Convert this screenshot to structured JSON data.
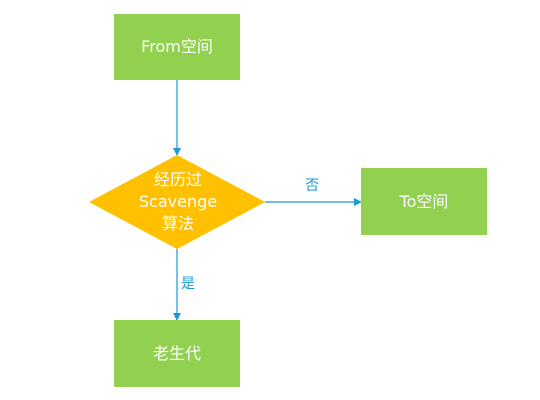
{
  "nodes": {
    "from_space": "From空间",
    "decision_line1": "经历过",
    "decision_line2": "Scavenge",
    "decision_line3": "算法",
    "to_space": "To空间",
    "old_gen": "老生代"
  },
  "edges": {
    "no_label": "否",
    "yes_label": "是"
  },
  "colors": {
    "box": "#92d050",
    "diamond": "#ffc000",
    "connector": "#1a9ad6"
  }
}
